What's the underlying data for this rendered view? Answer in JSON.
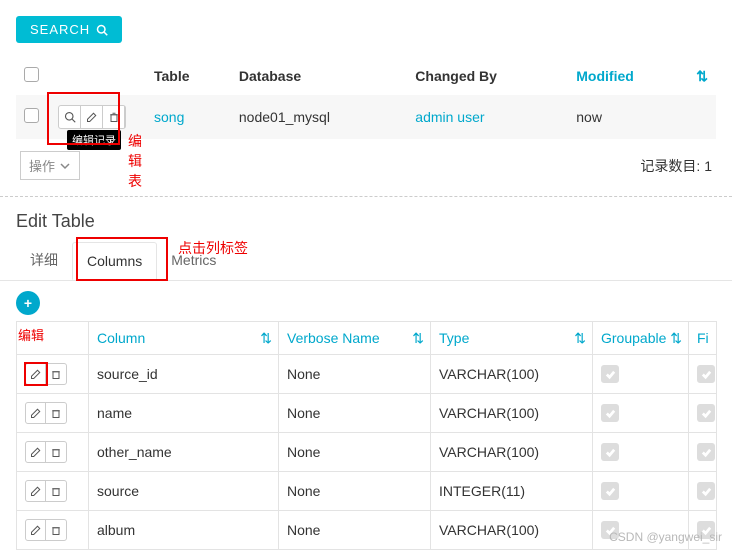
{
  "search": {
    "label": "SEARCH"
  },
  "table_list": {
    "headers": {
      "table": "Table",
      "database": "Database",
      "changed_by": "Changed By",
      "modified": "Modified"
    },
    "row": {
      "table": "song",
      "database": "node01_mysql",
      "changed_by": "admin user",
      "modified": "now"
    },
    "tooltip": "编辑记录",
    "annot_edit_table": "编辑表",
    "ops_label": "操作",
    "count_label": "记录数目: 1"
  },
  "edit_section": {
    "title": "Edit Table",
    "tabs": {
      "detail": "详细",
      "columns": "Columns",
      "metrics": "Metrics"
    },
    "annot_click_col": "点击列标签",
    "annot_edit": "编辑"
  },
  "columns_table": {
    "headers": {
      "column": "Column",
      "verbose": "Verbose Name",
      "type": "Type",
      "groupable": "Groupable",
      "fi": "Fi"
    },
    "rows": [
      {
        "column": "source_id",
        "verbose": "None",
        "type": "VARCHAR(100)"
      },
      {
        "column": "name",
        "verbose": "None",
        "type": "VARCHAR(100)"
      },
      {
        "column": "other_name",
        "verbose": "None",
        "type": "VARCHAR(100)"
      },
      {
        "column": "source",
        "verbose": "None",
        "type": "INTEGER(11)"
      },
      {
        "column": "album",
        "verbose": "None",
        "type": "VARCHAR(100)"
      }
    ]
  },
  "watermark": "CSDN @yangwei_sir"
}
